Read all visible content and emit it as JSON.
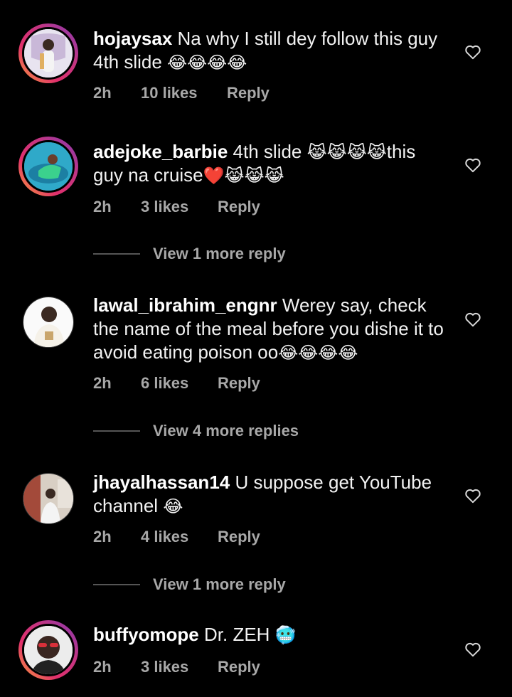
{
  "comments": [
    {
      "username": "hojaysax",
      "text": "Na why I still dey follow this guy 4th slide",
      "emoji": "😂😂😂😂",
      "time": "2h",
      "likes": "10 likes",
      "reply": "Reply"
    },
    {
      "username": "adejoke_barbie",
      "text": "4th slide",
      "emoji": "😹😹😹😹",
      "text2": "this guy na cruise",
      "emoji2": "❤️😹😹😹",
      "time": "2h",
      "likes": "3 likes",
      "reply": "Reply",
      "view_more": "View 1 more reply"
    },
    {
      "username": "lawal_ibrahim_engnr",
      "text": "Werey say, check the name of the meal before you dishe it to avoid eating poison oo",
      "emoji": "😂😂😂😂",
      "time": "2h",
      "likes": "6 likes",
      "reply": "Reply",
      "view_more": "View 4 more replies"
    },
    {
      "username": "jhayalhassan14",
      "text": "U suppose get YouTube channel",
      "emoji": "😂",
      "time": "2h",
      "likes": "4 likes",
      "reply": "Reply",
      "view_more": "View 1 more reply"
    },
    {
      "username": "buffyomope",
      "text": "Dr. ZEH",
      "emoji": "🥶",
      "time": "2h",
      "likes": "3 likes",
      "reply": "Reply"
    }
  ]
}
